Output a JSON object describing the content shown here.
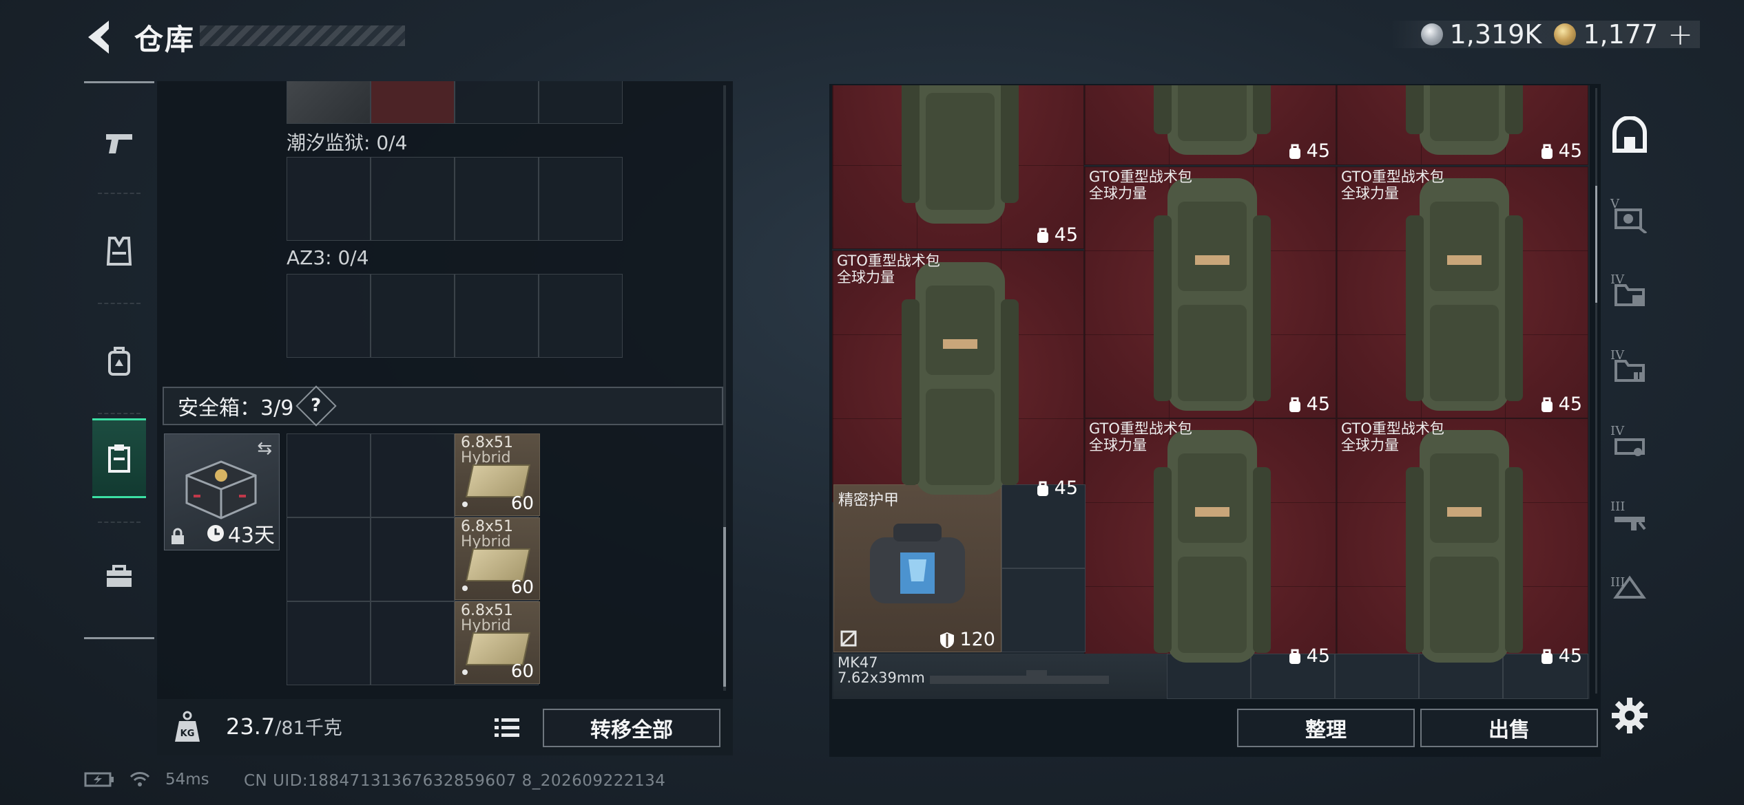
{
  "header": {
    "title": "仓库",
    "currency": [
      {
        "icon": "silver-coin-icon",
        "amount": "1,319K"
      },
      {
        "icon": "gold-coin-icon",
        "amount": "1,177"
      }
    ],
    "plus_label": "+"
  },
  "left_nav": {
    "items": [
      {
        "name": "weapons",
        "icon": "pistol-icon"
      },
      {
        "name": "armor",
        "icon": "vest-icon"
      },
      {
        "name": "backpack",
        "icon": "backpack-icon"
      },
      {
        "name": "container",
        "icon": "clipboard-icon",
        "active": true
      },
      {
        "name": "toolbox",
        "icon": "toolbox-icon"
      }
    ]
  },
  "left_panel": {
    "sections": [
      {
        "label": "潮汐监狱: 0/4"
      },
      {
        "label": "AZ3: 0/4"
      }
    ],
    "safe_box": {
      "label": "安全箱：3/9",
      "help": "?",
      "days": "43天"
    },
    "ammo": [
      {
        "name": "6.8x51",
        "sub": "Hybrid",
        "qty": "60"
      },
      {
        "name": "6.8x51",
        "sub": "Hybrid",
        "qty": "60"
      },
      {
        "name": "6.8x51",
        "sub": "Hybrid",
        "qty": "60"
      }
    ],
    "weight": {
      "current": "23.7",
      "max": "/81千克"
    },
    "transfer_all": "转移全部"
  },
  "stash": {
    "backpacks": [
      {
        "name": "",
        "brand": "",
        "capacity": "45"
      },
      {
        "name": "",
        "brand": "",
        "capacity": "45"
      },
      {
        "name": "",
        "brand": "",
        "capacity": "45"
      },
      {
        "name": "GTO重型战术包",
        "brand": "全球力量",
        "capacity": "45"
      },
      {
        "name": "GTO重型战术包",
        "brand": "全球力量",
        "capacity": "45"
      },
      {
        "name": "GTO重型战术包",
        "brand": "全球力量",
        "capacity": "45"
      },
      {
        "name": "GTO重型战术包",
        "brand": "全球力量",
        "capacity": "45"
      },
      {
        "name": "GTO重型战术包",
        "brand": "全球力量",
        "capacity": "45"
      }
    ],
    "armor": {
      "name": "精密护甲",
      "durability": "120"
    },
    "weapon": {
      "name": "MK47",
      "caliber": "7.62x39mm"
    },
    "sort_label": "整理",
    "sell_label": "出售"
  },
  "right_nav": {
    "items": [
      {
        "name": "stash-home",
        "tier": ""
      },
      {
        "name": "tier-v-gear",
        "tier": "V"
      },
      {
        "name": "tier-iv-folder-a",
        "tier": "IV"
      },
      {
        "name": "tier-iv-folder-b",
        "tier": "IV"
      },
      {
        "name": "tier-iv-gun",
        "tier": "IV"
      },
      {
        "name": "tier-iii-rifle",
        "tier": "III"
      },
      {
        "name": "tier-iii-item",
        "tier": "III"
      }
    ]
  },
  "status": {
    "ping": "54ms",
    "uid": "CN UID:18847131367632859607 8_202609222134"
  },
  "colors": {
    "accent_active": "#3ce0a4",
    "backpack_bg": "#5a1f25",
    "armor_bg": "#54473b"
  }
}
